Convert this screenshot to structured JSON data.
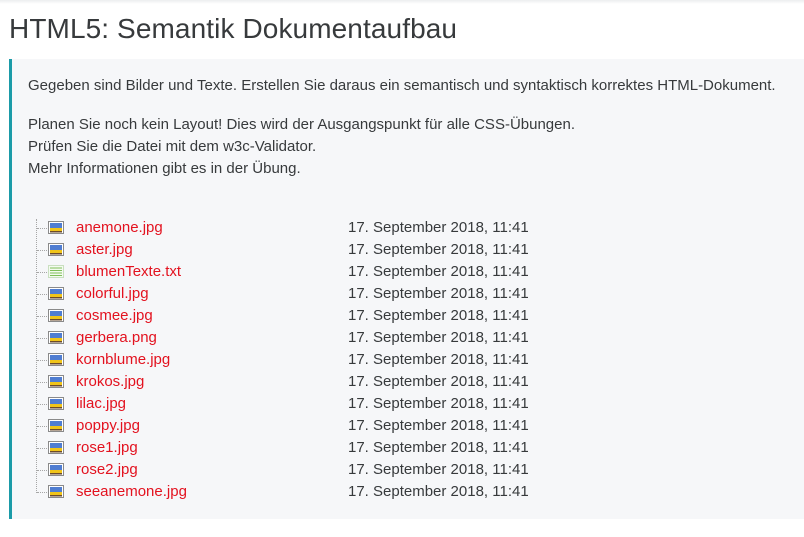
{
  "page": {
    "title": "HTML5: Semantik Dokumentaufbau"
  },
  "intro": {
    "paragraph1": "Gegeben sind Bilder und Texte. Erstellen Sie daraus ein semantisch und syntaktisch korrektes HTML-Dokument.",
    "lines": [
      "Planen Sie noch kein Layout! Dies wird der Ausgangspunkt für alle CSS-Übungen.",
      "Prüfen Sie die Datei mit dem w3c-Validator.",
      "Mehr Informationen gibt es in der Übung."
    ]
  },
  "colors": {
    "accent": "#1b9ba8",
    "link": "#e3121f",
    "box_background": "#f6f7f9",
    "text": "#373a3c"
  },
  "files": [
    {
      "name": "anemone.jpg",
      "date": "17. September 2018, 11:41",
      "icon": "image-file-icon"
    },
    {
      "name": "aster.jpg",
      "date": "17. September 2018, 11:41",
      "icon": "image-file-icon"
    },
    {
      "name": "blumenTexte.txt",
      "date": "17. September 2018, 11:41",
      "icon": "text-file-icon"
    },
    {
      "name": "colorful.jpg",
      "date": "17. September 2018, 11:41",
      "icon": "image-file-icon"
    },
    {
      "name": "cosmee.jpg",
      "date": "17. September 2018, 11:41",
      "icon": "image-file-icon"
    },
    {
      "name": "gerbera.png",
      "date": "17. September 2018, 11:41",
      "icon": "image-file-icon"
    },
    {
      "name": "kornblume.jpg",
      "date": "17. September 2018, 11:41",
      "icon": "image-file-icon"
    },
    {
      "name": "krokos.jpg",
      "date": "17. September 2018, 11:41",
      "icon": "image-file-icon"
    },
    {
      "name": "lilac.jpg",
      "date": "17. September 2018, 11:41",
      "icon": "image-file-icon"
    },
    {
      "name": "poppy.jpg",
      "date": "17. September 2018, 11:41",
      "icon": "image-file-icon"
    },
    {
      "name": "rose1.jpg",
      "date": "17. September 2018, 11:41",
      "icon": "image-file-icon"
    },
    {
      "name": "rose2.jpg",
      "date": "17. September 2018, 11:41",
      "icon": "image-file-icon"
    },
    {
      "name": "seeanemone.jpg",
      "date": "17. September 2018, 11:41",
      "icon": "image-file-icon"
    }
  ]
}
